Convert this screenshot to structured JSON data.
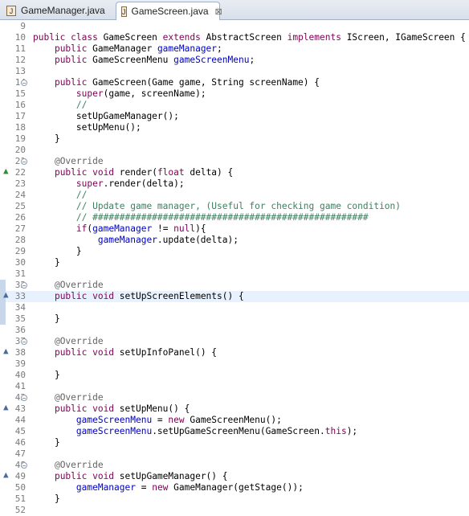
{
  "tabs": [
    {
      "label": "GameManager.java",
      "icon": "java-file-icon",
      "active": false
    },
    {
      "label": "GameScreen.java",
      "icon": "java-file-icon",
      "active": true,
      "close_icon": "⊠"
    }
  ],
  "editor": {
    "current_line": 33,
    "lines": [
      {
        "n": "9",
        "fold": false,
        "marker": null,
        "tokens": []
      },
      {
        "n": "10",
        "fold": false,
        "marker": null,
        "tokens": [
          [
            "kw",
            "public class "
          ],
          [
            "",
            "GameScreen "
          ],
          [
            "kw",
            "extends "
          ],
          [
            "",
            "AbstractScreen "
          ],
          [
            "kw",
            "implements "
          ],
          [
            "",
            "IScreen, IGameScreen {"
          ]
        ]
      },
      {
        "n": "11",
        "fold": false,
        "marker": null,
        "tokens": [
          [
            "",
            "    "
          ],
          [
            "kw",
            "public "
          ],
          [
            "",
            "GameManager "
          ],
          [
            "fld",
            "gameManager"
          ],
          [
            "",
            ";"
          ]
        ]
      },
      {
        "n": "12",
        "fold": false,
        "marker": null,
        "tokens": [
          [
            "",
            "    "
          ],
          [
            "kw",
            "public "
          ],
          [
            "",
            "GameScreenMenu "
          ],
          [
            "fld",
            "gameScreenMenu"
          ],
          [
            "",
            ";"
          ]
        ]
      },
      {
        "n": "13",
        "fold": false,
        "marker": null,
        "tokens": []
      },
      {
        "n": "14",
        "fold": true,
        "marker": null,
        "tokens": [
          [
            "",
            "    "
          ],
          [
            "kw",
            "public "
          ],
          [
            "",
            "GameScreen(Game game, String screenName) {"
          ]
        ]
      },
      {
        "n": "15",
        "fold": false,
        "marker": null,
        "tokens": [
          [
            "",
            "        "
          ],
          [
            "kw",
            "super"
          ],
          [
            "",
            "(game, screenName);"
          ]
        ]
      },
      {
        "n": "16",
        "fold": false,
        "marker": null,
        "tokens": [
          [
            "",
            "        "
          ],
          [
            "cm",
            "//"
          ]
        ]
      },
      {
        "n": "17",
        "fold": false,
        "marker": null,
        "tokens": [
          [
            "",
            "        setUpGameManager();"
          ]
        ]
      },
      {
        "n": "18",
        "fold": false,
        "marker": null,
        "tokens": [
          [
            "",
            "        setUpMenu();"
          ]
        ]
      },
      {
        "n": "19",
        "fold": false,
        "marker": null,
        "tokens": [
          [
            "",
            "    }"
          ]
        ]
      },
      {
        "n": "20",
        "fold": false,
        "marker": null,
        "tokens": []
      },
      {
        "n": "21",
        "fold": true,
        "marker": null,
        "tokens": [
          [
            "",
            "    "
          ],
          [
            "an",
            "@Override"
          ]
        ]
      },
      {
        "n": "22",
        "fold": false,
        "marker": "override-green",
        "tokens": [
          [
            "",
            "    "
          ],
          [
            "kw",
            "public void "
          ],
          [
            "",
            "render("
          ],
          [
            "kw",
            "float "
          ],
          [
            "",
            "delta) {"
          ]
        ]
      },
      {
        "n": "23",
        "fold": false,
        "marker": null,
        "tokens": [
          [
            "",
            "        "
          ],
          [
            "kw",
            "super"
          ],
          [
            "",
            ".render(delta);"
          ]
        ]
      },
      {
        "n": "24",
        "fold": false,
        "marker": null,
        "tokens": [
          [
            "",
            "        "
          ],
          [
            "cm",
            "//"
          ]
        ]
      },
      {
        "n": "25",
        "fold": false,
        "marker": null,
        "tokens": [
          [
            "",
            "        "
          ],
          [
            "cm",
            "// Update game manager, (Useful for checking game condition)"
          ]
        ]
      },
      {
        "n": "26",
        "fold": false,
        "marker": null,
        "tokens": [
          [
            "",
            "        "
          ],
          [
            "cm",
            "// ###################################################"
          ]
        ]
      },
      {
        "n": "27",
        "fold": false,
        "marker": null,
        "tokens": [
          [
            "",
            "        "
          ],
          [
            "kw",
            "if"
          ],
          [
            "",
            "("
          ],
          [
            "fld",
            "gameManager"
          ],
          [
            "",
            " != "
          ],
          [
            "kw",
            "null"
          ],
          [
            "",
            "){"
          ]
        ]
      },
      {
        "n": "28",
        "fold": false,
        "marker": null,
        "tokens": [
          [
            "",
            "            "
          ],
          [
            "fld",
            "gameManager"
          ],
          [
            "",
            ".update(delta);"
          ]
        ]
      },
      {
        "n": "29",
        "fold": false,
        "marker": null,
        "tokens": [
          [
            "",
            "        }"
          ]
        ]
      },
      {
        "n": "30",
        "fold": false,
        "marker": null,
        "tokens": [
          [
            "",
            "    }"
          ]
        ]
      },
      {
        "n": "31",
        "fold": false,
        "marker": null,
        "tokens": []
      },
      {
        "n": "32",
        "fold": true,
        "marker": "occurrence",
        "tokens": [
          [
            "",
            "    "
          ],
          [
            "an",
            "@Override"
          ]
        ]
      },
      {
        "n": "33",
        "fold": false,
        "marker": "override-blue-occ",
        "tokens": [
          [
            "",
            "    "
          ],
          [
            "kw",
            "public void "
          ],
          [
            "",
            "setUpScreenElements() {"
          ]
        ]
      },
      {
        "n": "34",
        "fold": false,
        "marker": "occurrence",
        "tokens": []
      },
      {
        "n": "35",
        "fold": false,
        "marker": "occurrence",
        "tokens": [
          [
            "",
            "    }"
          ]
        ]
      },
      {
        "n": "36",
        "fold": false,
        "marker": null,
        "tokens": []
      },
      {
        "n": "37",
        "fold": true,
        "marker": null,
        "tokens": [
          [
            "",
            "    "
          ],
          [
            "an",
            "@Override"
          ]
        ]
      },
      {
        "n": "38",
        "fold": false,
        "marker": "override-blue",
        "tokens": [
          [
            "",
            "    "
          ],
          [
            "kw",
            "public void "
          ],
          [
            "",
            "setUpInfoPanel() {"
          ]
        ]
      },
      {
        "n": "39",
        "fold": false,
        "marker": null,
        "tokens": []
      },
      {
        "n": "40",
        "fold": false,
        "marker": null,
        "tokens": [
          [
            "",
            "    }"
          ]
        ]
      },
      {
        "n": "41",
        "fold": false,
        "marker": null,
        "tokens": []
      },
      {
        "n": "42",
        "fold": true,
        "marker": null,
        "tokens": [
          [
            "",
            "    "
          ],
          [
            "an",
            "@Override"
          ]
        ]
      },
      {
        "n": "43",
        "fold": false,
        "marker": "override-blue",
        "tokens": [
          [
            "",
            "    "
          ],
          [
            "kw",
            "public void "
          ],
          [
            "",
            "setUpMenu() {"
          ]
        ]
      },
      {
        "n": "44",
        "fold": false,
        "marker": null,
        "tokens": [
          [
            "",
            "        "
          ],
          [
            "fld",
            "gameScreenMenu"
          ],
          [
            "",
            " = "
          ],
          [
            "kw",
            "new "
          ],
          [
            "",
            "GameScreenMenu();"
          ]
        ]
      },
      {
        "n": "45",
        "fold": false,
        "marker": null,
        "tokens": [
          [
            "",
            "        "
          ],
          [
            "fld",
            "gameScreenMenu"
          ],
          [
            "",
            ".setUpGameScreenMenu(GameScreen."
          ],
          [
            "kw",
            "this"
          ],
          [
            "",
            ");"
          ]
        ]
      },
      {
        "n": "46",
        "fold": false,
        "marker": null,
        "tokens": [
          [
            "",
            "    }"
          ]
        ]
      },
      {
        "n": "47",
        "fold": false,
        "marker": null,
        "tokens": []
      },
      {
        "n": "48",
        "fold": true,
        "marker": null,
        "tokens": [
          [
            "",
            "    "
          ],
          [
            "an",
            "@Override"
          ]
        ]
      },
      {
        "n": "49",
        "fold": false,
        "marker": "override-blue",
        "tokens": [
          [
            "",
            "    "
          ],
          [
            "kw",
            "public void "
          ],
          [
            "",
            "setUpGameManager() {"
          ]
        ]
      },
      {
        "n": "50",
        "fold": false,
        "marker": null,
        "tokens": [
          [
            "",
            "        "
          ],
          [
            "fld",
            "gameManager"
          ],
          [
            "",
            " = "
          ],
          [
            "kw",
            "new "
          ],
          [
            "",
            "GameManager(getStage());"
          ]
        ]
      },
      {
        "n": "51",
        "fold": false,
        "marker": null,
        "tokens": [
          [
            "",
            "    }"
          ]
        ]
      },
      {
        "n": "52",
        "fold": false,
        "marker": null,
        "tokens": []
      }
    ]
  }
}
